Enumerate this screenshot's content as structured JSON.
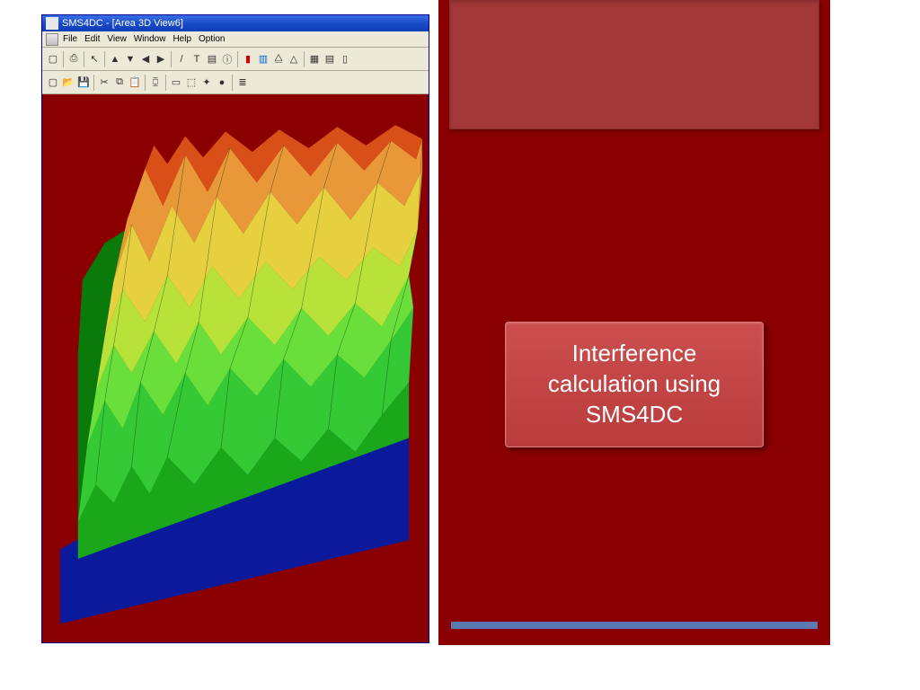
{
  "app": {
    "title": "SMS4DC - [Area 3D View6]",
    "menus": [
      "File",
      "Edit",
      "View",
      "Window",
      "Help",
      "Option"
    ]
  },
  "slide": {
    "title": "Interference calculation using SMS4DC"
  }
}
